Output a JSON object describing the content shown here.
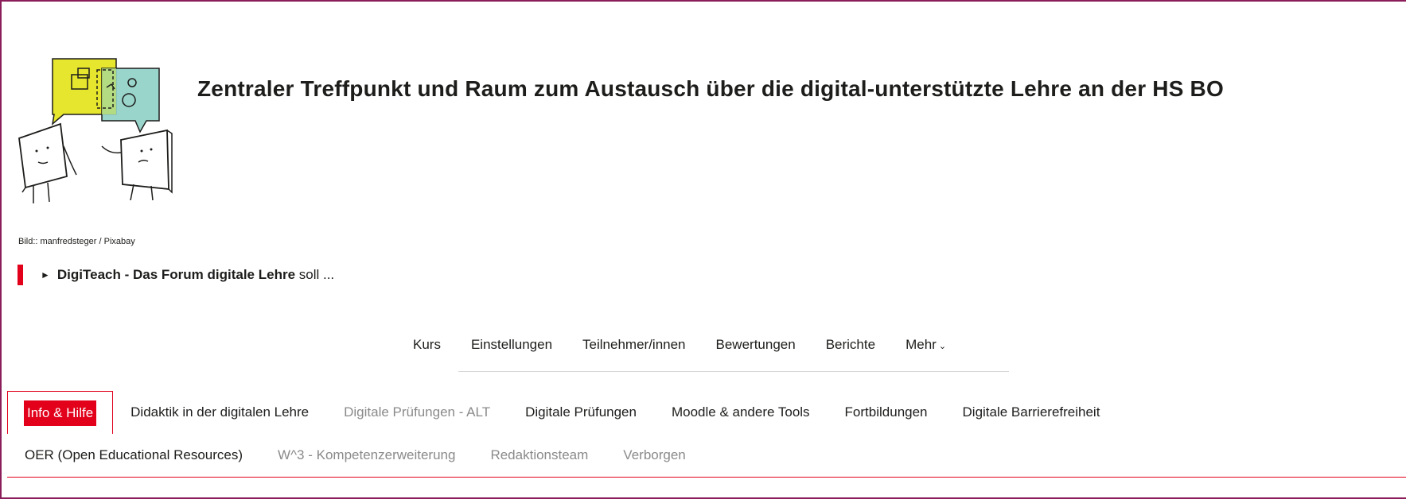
{
  "header": {
    "headline": "Zentraler Treffpunkt und Raum zum Austausch über die digital-unterstützte Lehre an der HS BO",
    "image_credit": "Bild:: manfredsteger / Pixabay",
    "illustration": "two-people-speech-bubbles-illustration"
  },
  "summary": {
    "bold_text": "DigiTeach - Das Forum digitale Lehre",
    "rest_text": " soll ...",
    "accent_color": "#e2001a"
  },
  "course_nav": {
    "items": [
      {
        "label": "Kurs"
      },
      {
        "label": "Einstellungen"
      },
      {
        "label": "Teilnehmer/innen"
      },
      {
        "label": "Bewertungen"
      },
      {
        "label": "Berichte"
      },
      {
        "label": "Mehr"
      }
    ]
  },
  "tabs": {
    "row1": [
      {
        "label": "Info & Hilfe",
        "state": "active"
      },
      {
        "label": "Didaktik in der digitalen Lehre",
        "state": "normal"
      },
      {
        "label": "Digitale Prüfungen - ALT",
        "state": "muted"
      },
      {
        "label": "Digitale Prüfungen",
        "state": "normal"
      },
      {
        "label": "Moodle & andere Tools",
        "state": "normal"
      },
      {
        "label": "Fortbildungen",
        "state": "normal"
      },
      {
        "label": "Digitale Barrierefreiheit",
        "state": "normal"
      }
    ],
    "row2": [
      {
        "label": "OER (Open Educational Resources)",
        "state": "normal"
      },
      {
        "label": "W^3 - Kompetenzerweiterung",
        "state": "muted"
      },
      {
        "label": "Redaktionsteam",
        "state": "muted"
      },
      {
        "label": "Verborgen",
        "state": "muted"
      }
    ],
    "active_color": "#e2001a"
  }
}
